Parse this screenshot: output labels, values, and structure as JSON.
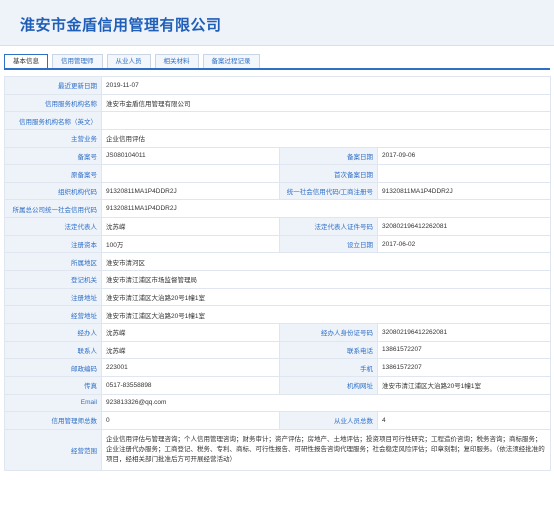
{
  "company": {
    "title": "淮安市金盾信用管理有限公司"
  },
  "tabs": [
    {
      "label": "基本信息",
      "active": true
    },
    {
      "label": "信用管理师",
      "active": false
    },
    {
      "label": "从业人员",
      "active": false
    },
    {
      "label": "相关材料",
      "active": false
    },
    {
      "label": "备案过程记录",
      "active": false
    }
  ],
  "info": {
    "last_update_label": "最近更新日期",
    "last_update": "2019-11-07",
    "org_name_label": "信用服务机构名称",
    "org_name": "淮安市金盾信用管理有限公司",
    "org_name_en_label": "信用服务机构名称（英文）",
    "org_name_en": "",
    "main_business_label": "主营业务",
    "main_business": "企业信用评估",
    "record_no_label": "备案号",
    "record_no": "JS080104011",
    "record_date_label": "备案日期",
    "record_date": "2017-09-06",
    "orig_record_no_label": "原备案号",
    "orig_record_no": "",
    "first_record_date_label": "首次备案日期",
    "first_record_date": "",
    "org_code_label": "组织机构代码",
    "org_code": "91320811MA1P4DDR2J",
    "uscc_label": "统一社会信用代码/工商注册号",
    "uscc": "91320811MA1P4DDR2J",
    "parent_uscc_label": "所属总公司统一社会信用代码",
    "parent_uscc": "91320811MA1P4DDR2J",
    "legal_rep_label": "法定代表人",
    "legal_rep": "沈苏嵘",
    "legal_rep_id_label": "法定代表人证件号码",
    "legal_rep_id": "320802196412262081",
    "reg_capital_label": "注册资本",
    "reg_capital": "100万",
    "founded_label": "设立日期",
    "founded": "2017-06-02",
    "region_label": "所属地区",
    "region": "淮安市清河区",
    "reg_authority_label": "登记机关",
    "reg_authority": "淮安市清江浦区市场监督管理局",
    "reg_address_label": "注册地址",
    "reg_address": "淮安市清江浦区大治路20号1幢1室",
    "biz_address_label": "经营地址",
    "biz_address": "淮安市清江浦区大治路20号1幢1室",
    "handler_label": "经办人",
    "handler": "沈苏嵘",
    "handler_id_label": "经办人身份证号码",
    "handler_id": "320802196412262081",
    "contact_label": "联系人",
    "contact": "沈苏嵘",
    "contact_phone_label": "联系电话",
    "contact_phone": "13861572207",
    "postcode_label": "邮政编码",
    "postcode": "223001",
    "mobile_label": "手机",
    "mobile": "13861572207",
    "fax_label": "传真",
    "fax": "0517-83558898",
    "website_label": "机构网址",
    "website": "淮安市清江浦区大治路20号1幢1室",
    "email_label": "Email",
    "email": "923813326@qq.com",
    "credit_mgr_count_label": "信用管理师总数",
    "credit_mgr_count": "0",
    "staff_count_label": "从业人员总数",
    "staff_count": "4",
    "scope_label": "经营范围",
    "scope": "企业信用评估与管理咨询；个人信用管理咨询；财务审计；资产评估；房地产、土地评估；投资项目可行性研究；工程造价咨询；税务咨询；商标服务；企业注册代办服务；工商登记、税务、专利、商标、可行性报告、可研性报告咨询代理服务；社会稳定风险评估；印章刻制；复印服务。（依法须经批准的项目，经相关部门批准后方可开展经营活动）"
  }
}
